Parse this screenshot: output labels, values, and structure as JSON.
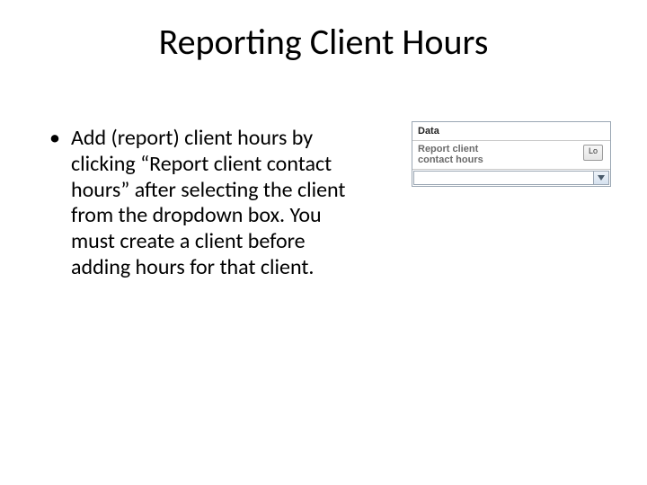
{
  "title": "Reporting Client Hours",
  "bullet": "Add (report) client hours by clicking “Report client contact hours” after selecting the client from the dropdown box. You must create a client before adding hours for that client.",
  "panel": {
    "header": "Data",
    "label_line1": "Report client",
    "label_line2": "contact hours",
    "button": "Lo"
  }
}
